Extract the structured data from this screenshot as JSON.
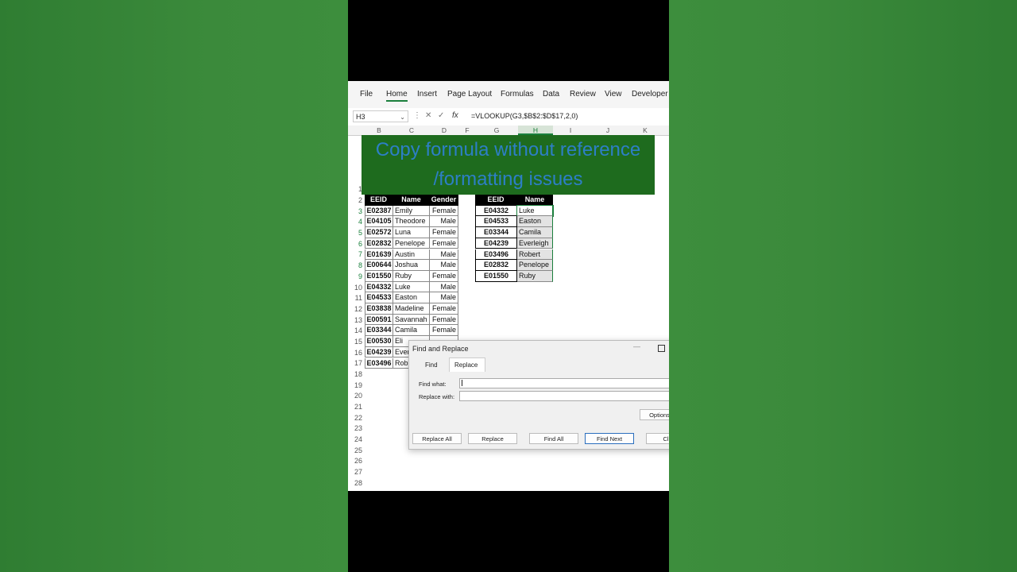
{
  "menu": [
    "File",
    "Home",
    "Insert",
    "Page Layout",
    "Formulas",
    "Data",
    "Review",
    "View",
    "Developer"
  ],
  "menu_active": "Home",
  "formula_bar": {
    "name_box": "H3",
    "formula": "=VLOOKUP(G3,$B$2:$D$17,2,0)",
    "cancel_icon": "close-icon",
    "enter_icon": "check-icon",
    "fx_label": "fx"
  },
  "columns": [
    "B",
    "C",
    "D",
    "F",
    "G",
    "H",
    "I",
    "J",
    "K"
  ],
  "rows": [
    "1",
    "2",
    "3",
    "4",
    "5",
    "6",
    "7",
    "8",
    "9",
    "10",
    "11",
    "12",
    "13",
    "14",
    "15",
    "16",
    "17",
    "18",
    "19",
    "20",
    "21",
    "22",
    "23",
    "24",
    "25",
    "26",
    "27",
    "28"
  ],
  "banner": {
    "line1": "Copy formula without reference",
    "line2": "/formatting issues",
    "bg_color": "#1e6b1e",
    "text_color": "#2d7fc6"
  },
  "left_table": {
    "headers": [
      "EEID",
      "Name",
      "Gender"
    ],
    "rows": [
      [
        "E02387",
        "Emily",
        "Female"
      ],
      [
        "E04105",
        "Theodore",
        "Male"
      ],
      [
        "E02572",
        "Luna",
        "Female"
      ],
      [
        "E02832",
        "Penelope",
        "Female"
      ],
      [
        "E01639",
        "Austin",
        "Male"
      ],
      [
        "E00644",
        "Joshua",
        "Male"
      ],
      [
        "E01550",
        "Ruby",
        "Female"
      ],
      [
        "E04332",
        "Luke",
        "Male"
      ],
      [
        "E04533",
        "Easton",
        "Male"
      ],
      [
        "E03838",
        "Madeline",
        "Female"
      ],
      [
        "E00591",
        "Savannah",
        "Female"
      ],
      [
        "E03344",
        "Camila",
        "Female"
      ],
      [
        "E00530",
        "Eli",
        ""
      ],
      [
        "E04239",
        "Ever",
        ""
      ],
      [
        "E03496",
        "Rob",
        ""
      ]
    ]
  },
  "right_table": {
    "headers": [
      "EEID",
      "Name"
    ],
    "rows": [
      [
        "E04332",
        "Luke"
      ],
      [
        "E04533",
        "Easton"
      ],
      [
        "E03344",
        "Camila"
      ],
      [
        "E04239",
        "Everleigh"
      ],
      [
        "E03496",
        "Robert"
      ],
      [
        "E02832",
        "Penelope"
      ],
      [
        "E01550",
        "Ruby"
      ]
    ]
  },
  "dialog": {
    "title": "Find and Replace",
    "tabs": [
      "Find",
      "Replace"
    ],
    "active_tab": "Replace",
    "find_label": "Find what:",
    "replace_label": "Replace with:",
    "find_value": "",
    "replace_value": "",
    "options_label": "Options",
    "buttons": [
      "Replace All",
      "Replace",
      "Find All",
      "Find Next",
      "Cl"
    ],
    "default_button": "Find Next"
  }
}
